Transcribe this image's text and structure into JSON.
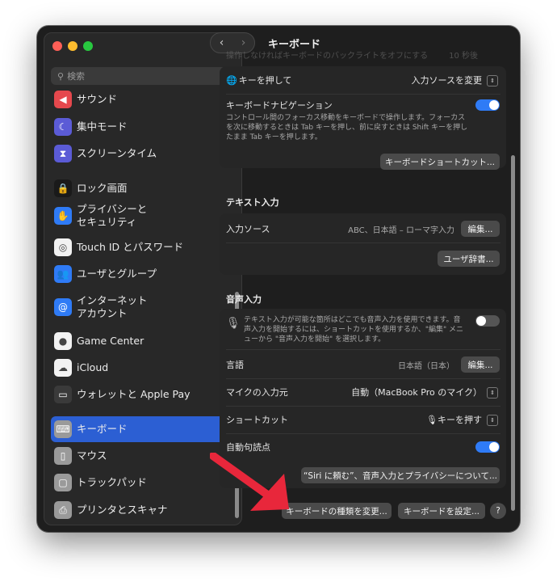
{
  "window": {
    "title": "キーボード"
  },
  "colors": {
    "accent": "#2c5fd3",
    "toggle_on": "#2f7bf6",
    "arrow": "#e8273b"
  },
  "sidebar": {
    "search_placeholder": "検索",
    "items": [
      {
        "label": "サウンド",
        "icon": "speaker-icon",
        "color": "#e5484d"
      },
      {
        "label": "集中モード",
        "icon": "moon-icon",
        "color": "#5b5bd6"
      },
      {
        "label": "スクリーンタイム",
        "icon": "hourglass-icon",
        "color": "#5b5bd6"
      },
      {
        "label": "ロック画面",
        "icon": "lock-icon",
        "color": "#1a1a1a"
      },
      {
        "label": "プライバシーと\nセキュリティ",
        "icon": "hand-icon",
        "color": "#2f7bf6"
      },
      {
        "label": "Touch ID とパスワード",
        "icon": "fingerprint-icon",
        "color": "#f2f2f2"
      },
      {
        "label": "ユーザとグループ",
        "icon": "users-icon",
        "color": "#2f7bf6"
      },
      {
        "label": "インターネット\nアカウント",
        "icon": "at-icon",
        "color": "#2f7bf6"
      },
      {
        "label": "Game Center",
        "icon": "gamecenter-icon",
        "color": "#f2f2f2"
      },
      {
        "label": "iCloud",
        "icon": "cloud-icon",
        "color": "#f2f2f2"
      },
      {
        "label": "ウォレットと Apple Pay",
        "icon": "wallet-icon",
        "color": "#3a3a3a"
      },
      {
        "label": "キーボード",
        "icon": "keyboard-icon",
        "color": "#9a9a9a",
        "selected": true
      },
      {
        "label": "マウス",
        "icon": "mouse-icon",
        "color": "#9a9a9a"
      },
      {
        "label": "トラックパッド",
        "icon": "trackpad-icon",
        "color": "#9a9a9a"
      },
      {
        "label": "プリンタとスキャナ",
        "icon": "printer-icon",
        "color": "#9a9a9a"
      }
    ]
  },
  "main": {
    "top_row": {
      "label": "操作しなければキーボードのバックライトをオフにする",
      "value": "10 秒後"
    },
    "globe_row": {
      "label": "キーを押して",
      "value": "入力ソースを変更"
    },
    "nav_row": {
      "label": "キーボードナビゲーション",
      "description": "コントロール間のフォーカス移動をキーボードで操作します。フォーカスを次に移動するときは Tab キーを押し、前に戻すときは Shift キーを押したまま Tab キーを押します。",
      "toggle": "on"
    },
    "shortcuts_button": "キーボードショートカット...",
    "text_input": {
      "section": "テキスト入力",
      "source_label": "入力ソース",
      "source_value": "ABC、日本語 – ローマ字入力",
      "edit_button": "編集...",
      "dictionary_button": "ユーザ辞書..."
    },
    "dictation": {
      "section": "音声入力",
      "description": "テキスト入力が可能な箇所はどこでも音声入力を使用できます。音声入力を開始するには、ショートカットを使用するか、\"編集\" メニューから \"音声入力を開始\" を選択します。",
      "toggle": "off",
      "language_label": "言語",
      "language_value": "日本語（日本）",
      "language_edit": "編集...",
      "mic_label": "マイクの入力元",
      "mic_value": "自動（MacBook Pro のマイク）",
      "shortcut_label": "ショートカット",
      "shortcut_value": "キーを押す",
      "punct_label": "自動句読点",
      "punct_toggle": "on",
      "siri_button": "“Siri に頼む”、音声入力とプライバシーについて..."
    },
    "footer": {
      "change_type": "キーボードの種類を変更...",
      "setup": "キーボードを設定...",
      "help": "?"
    }
  }
}
